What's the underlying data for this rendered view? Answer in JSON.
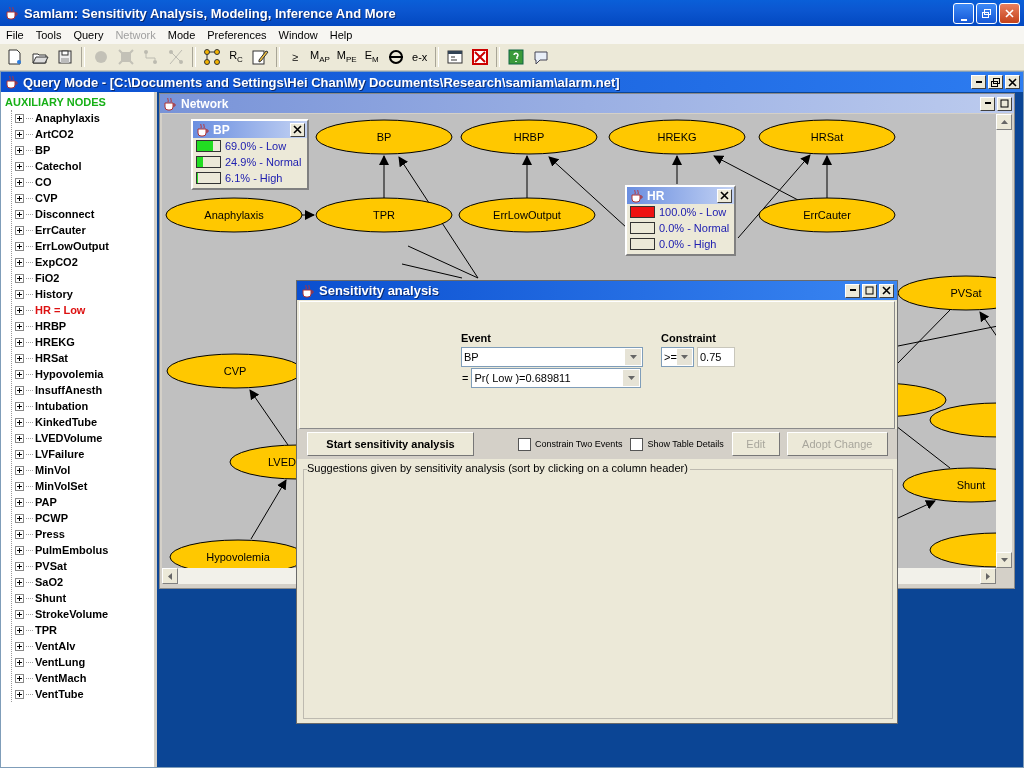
{
  "window": {
    "title": "Samlam: Sensitivity Analysis, Modeling, Inference And More"
  },
  "menu": [
    {
      "label": "File",
      "disabled": false
    },
    {
      "label": "Tools",
      "disabled": false
    },
    {
      "label": "Query",
      "disabled": false
    },
    {
      "label": "Network",
      "disabled": true
    },
    {
      "label": "Mode",
      "disabled": false
    },
    {
      "label": "Preferences",
      "disabled": false
    },
    {
      "label": "Window",
      "disabled": false
    },
    {
      "label": "Help",
      "disabled": false
    }
  ],
  "toolbar": [
    {
      "kind": "new",
      "disabled": false
    },
    {
      "kind": "open",
      "disabled": false
    },
    {
      "kind": "save",
      "disabled": false
    },
    {
      "kind": "separator"
    },
    {
      "kind": "node",
      "disabled": true
    },
    {
      "kind": "delete",
      "disabled": true
    },
    {
      "kind": "edge",
      "disabled": true
    },
    {
      "kind": "cut",
      "disabled": true
    },
    {
      "kind": "separator"
    },
    {
      "kind": "graph",
      "disabled": false
    },
    {
      "kind": "text",
      "label": "R$_{C}$",
      "disabled": false
    },
    {
      "kind": "edit",
      "disabled": false
    },
    {
      "kind": "separator"
    },
    {
      "kind": "text",
      "label": "≥",
      "disabled": false
    },
    {
      "kind": "text",
      "label": "M$_{AP}$",
      "disabled": false
    },
    {
      "kind": "text",
      "label": "M$_{PE}$",
      "disabled": false
    },
    {
      "kind": "text",
      "label": "E$_{M}$",
      "disabled": false
    },
    {
      "kind": "bar",
      "disabled": false
    },
    {
      "kind": "text",
      "label": "e-x",
      "disabled": false
    },
    {
      "kind": "separator"
    },
    {
      "kind": "panel",
      "disabled": false
    },
    {
      "kind": "close",
      "disabled": false
    },
    {
      "kind": "separator"
    },
    {
      "kind": "help",
      "disabled": false
    },
    {
      "kind": "bubble",
      "disabled": false
    }
  ],
  "query_window": {
    "title": "Query Mode - [C:\\Documents and Settings\\Hei Chan\\My Documents\\Research\\samiam\\alarm.net]"
  },
  "nodes_panel": {
    "heading": "AUXILIARY NODES",
    "items": [
      {
        "label": "Anaphylaxis",
        "evidence": false,
        "expanded": false
      },
      {
        "label": "ArtCO2",
        "evidence": false,
        "expanded": false
      },
      {
        "label": "BP",
        "evidence": false,
        "expanded": false
      },
      {
        "label": "Catechol",
        "evidence": false,
        "expanded": false
      },
      {
        "label": "CO",
        "evidence": false,
        "expanded": false
      },
      {
        "label": "CVP",
        "evidence": false,
        "expanded": false
      },
      {
        "label": "Disconnect",
        "evidence": false,
        "expanded": false
      },
      {
        "label": "ErrCauter",
        "evidence": false,
        "expanded": false
      },
      {
        "label": "ErrLowOutput",
        "evidence": false,
        "expanded": false
      },
      {
        "label": "ExpCO2",
        "evidence": false,
        "expanded": false
      },
      {
        "label": "FiO2",
        "evidence": false,
        "expanded": false
      },
      {
        "label": "History",
        "evidence": false,
        "expanded": false
      },
      {
        "label": "HR = Low",
        "evidence": true,
        "expanded": false
      },
      {
        "label": "HRBP",
        "evidence": false,
        "expanded": false
      },
      {
        "label": "HREKG",
        "evidence": false,
        "expanded": false
      },
      {
        "label": "HRSat",
        "evidence": false,
        "expanded": false
      },
      {
        "label": "Hypovolemia",
        "evidence": false,
        "expanded": false
      },
      {
        "label": "InsuffAnesth",
        "evidence": false,
        "expanded": false
      },
      {
        "label": "Intubation",
        "evidence": false,
        "expanded": false
      },
      {
        "label": "KinkedTube",
        "evidence": false,
        "expanded": false
      },
      {
        "label": "LVEDVolume",
        "evidence": false,
        "expanded": false
      },
      {
        "label": "LVFailure",
        "evidence": false,
        "expanded": false
      },
      {
        "label": "MinVol",
        "evidence": false,
        "expanded": false
      },
      {
        "label": "MinVolSet",
        "evidence": false,
        "expanded": false
      },
      {
        "label": "PAP",
        "evidence": false,
        "expanded": false
      },
      {
        "label": "PCWP",
        "evidence": false,
        "expanded": false
      },
      {
        "label": "Press",
        "evidence": false,
        "expanded": false
      },
      {
        "label": "PulmEmbolus",
        "evidence": false,
        "expanded": false
      },
      {
        "label": "PVSat",
        "evidence": false,
        "expanded": false
      },
      {
        "label": "SaO2",
        "evidence": false,
        "expanded": false
      },
      {
        "label": "Shunt",
        "evidence": false,
        "expanded": false
      },
      {
        "label": "StrokeVolume",
        "evidence": false,
        "expanded": false
      },
      {
        "label": "TPR",
        "evidence": false,
        "expanded": false
      },
      {
        "label": "VentAlv",
        "evidence": false,
        "expanded": false
      },
      {
        "label": "VentLung",
        "evidence": false,
        "expanded": false
      },
      {
        "label": "VentMach",
        "evidence": false,
        "expanded": false
      },
      {
        "label": "VentTube",
        "evidence": false,
        "expanded": false
      }
    ]
  },
  "network_window": {
    "title": "Network",
    "nodes": [
      {
        "label": "BP"
      },
      {
        "label": "HRBP"
      },
      {
        "label": "HREKG"
      },
      {
        "label": "HRSat"
      },
      {
        "label": "Anaphylaxis"
      },
      {
        "label": "TPR"
      },
      {
        "label": "ErrLowOutput"
      },
      {
        "label": "ErrCauter"
      },
      {
        "label": "PVSat"
      },
      {
        "label": "CVP"
      },
      {
        "label": "LVED"
      },
      {
        "label": "Hypovolemia"
      },
      {
        "label": "Shunt"
      }
    ],
    "monitors": [
      {
        "title": "BP",
        "evidence": false,
        "states": [
          {
            "label": "69.0% - Low",
            "level": 0.69
          },
          {
            "label": "24.9% - Normal",
            "level": 0.249
          },
          {
            "label": "6.1% - High",
            "level": 0.061
          }
        ]
      },
      {
        "title": "HR",
        "evidence": true,
        "states": [
          {
            "label": "100.0% - Low",
            "level": 1.0
          },
          {
            "label": "0.0% - Normal",
            "level": 0.0
          },
          {
            "label": "0.0% - High",
            "level": 0.0
          }
        ]
      }
    ]
  },
  "dialog": {
    "title": "Sensitivity analysis",
    "event_label": "Event",
    "event_variable": "BP",
    "equals": "=",
    "event_value": "Pr( Low )=0.689811",
    "constraint_label": "Constraint",
    "operator": ">=",
    "constraint_value": "0.75",
    "start_button": "Start sensitivity analysis",
    "options": [
      {
        "label": "Constrain Two Events",
        "checked": false
      },
      {
        "label": "Show Table Details",
        "checked": false
      }
    ],
    "buttons": [
      {
        "label": "Edit",
        "disabled": true
      },
      {
        "label": "Adopt Change",
        "disabled": true
      }
    ],
    "results_legend": "Suggestions given by sensitivity analysis (sort by clicking on a column header)"
  }
}
